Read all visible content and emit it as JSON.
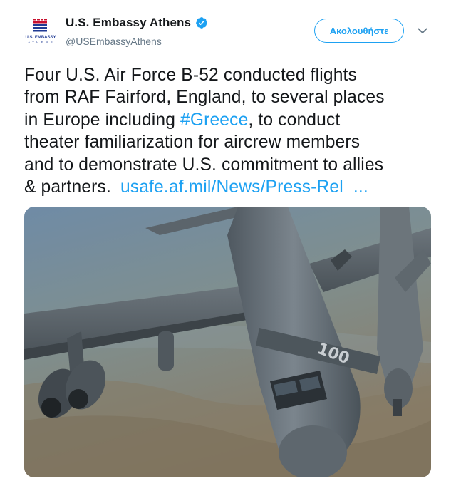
{
  "account": {
    "display_name": "U.S. Embassy Athens",
    "handle": "@USEmbassyAthens",
    "avatar_caption": "U.S. EMBASSY ATHENS",
    "verified_icon": "verified-badge-icon",
    "verified_color": "#1da1f2"
  },
  "follow_button": {
    "label": "Ακολουθήστε"
  },
  "menu": {
    "icon": "chevron-down-icon"
  },
  "tweet": {
    "line1": "Four U.S. Air Force B-52 conducted flights",
    "line2": "from RAF Fairford, England, to several places",
    "line3_prefix": "in Europe including ",
    "hashtag": "#Greece",
    "line3_suffix": ", to conduct",
    "line4": "theater familiarization for aircrew members",
    "line5": "and to demonstrate U.S. commitment to allies",
    "line6_prefix": "& partners.",
    "link_text": "usafe.af.mil/News/Press-Rel",
    "link_ellipsis": "..."
  },
  "photo": {
    "tail_marking": "100"
  },
  "colors": {
    "accent": "#1da1f2",
    "text": "#14171a",
    "secondary": "#657786"
  }
}
